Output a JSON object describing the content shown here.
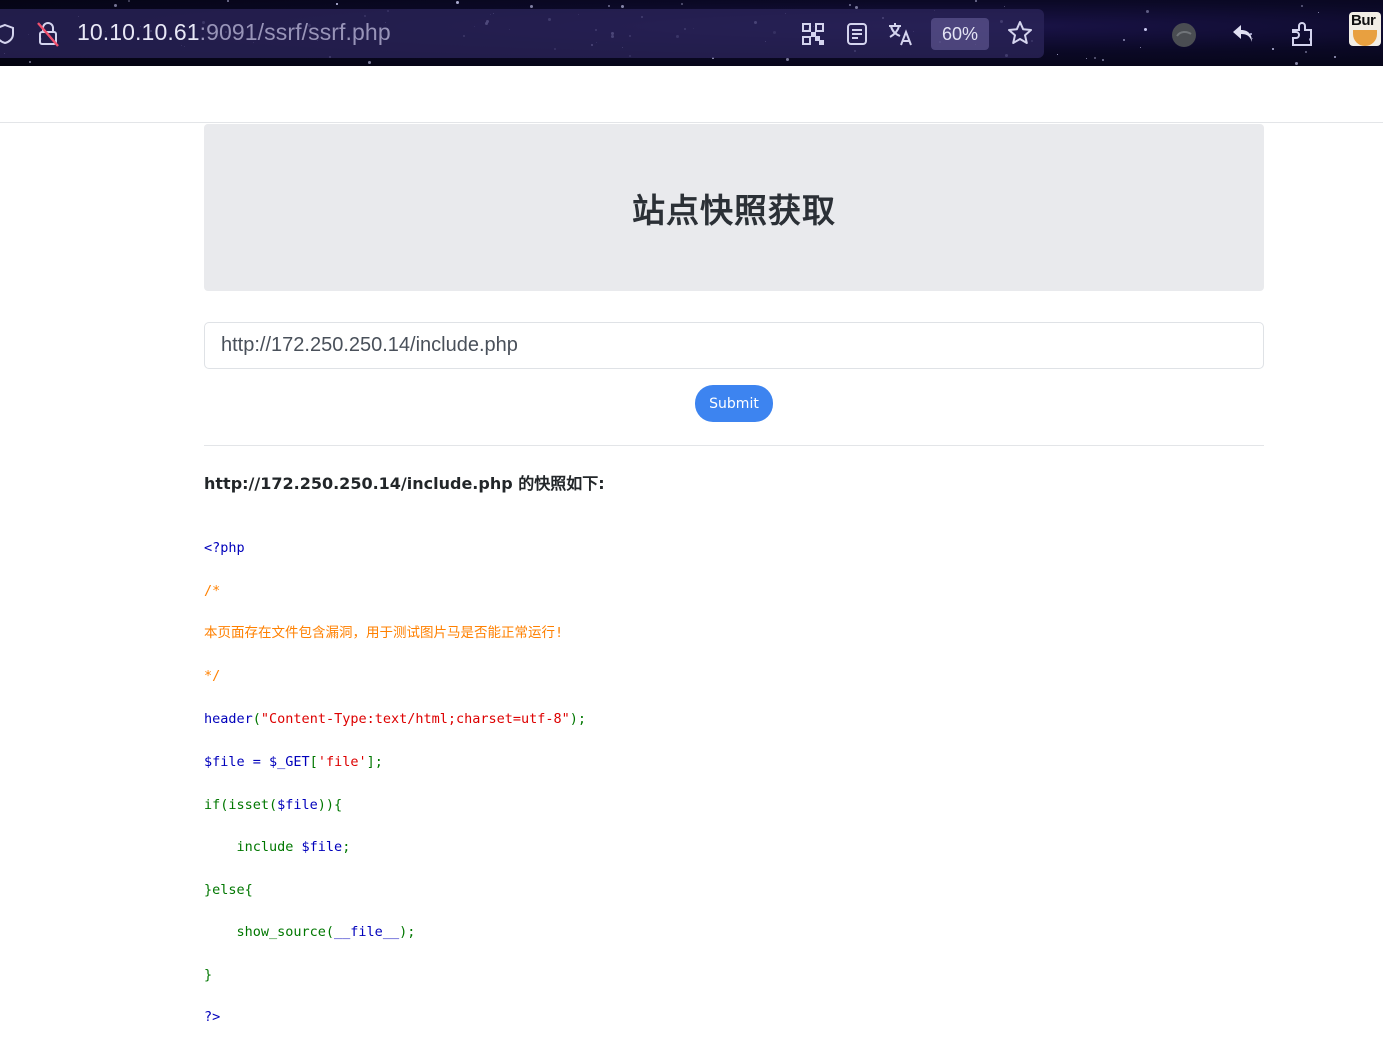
{
  "browser": {
    "url_host": "10.10.10.61",
    "url_path": ":9091/ssrf/ssrf.php",
    "zoom": "60%",
    "burp_label": "Bur",
    "icons": [
      "shield-icon",
      "insecure-lock-icon",
      "qr-code-icon",
      "reader-view-icon",
      "translate-icon",
      "bookmark-star-icon",
      "account-avatar-icon",
      "back-arrow-icon",
      "extensions-icon",
      "burp-extension-icon"
    ]
  },
  "page": {
    "title": "站点快照获取",
    "input_value": "http://172.250.250.14/include.php",
    "submit_label": "Submit",
    "snapshot_heading": "http://172.250.250.14/include.php 的快照如下:"
  },
  "code": {
    "l1": "<?php",
    "l2": "/*",
    "l3": "本页面存在文件包含漏洞，用于测试图片马是否能正常运行!",
    "l4": "*/",
    "l5_fn": "header",
    "l5_open": "(",
    "l5_str": "\"Content-Type:text/html;charset=utf-8\"",
    "l5_close": ");",
    "l6_var": "$file = $_GET",
    "l6_br1": "[",
    "l6_str": "'file'",
    "l6_br2": "];",
    "l7_kw": "if(isset(",
    "l7_var": "$file",
    "l7_kw2": ")){",
    "l8_kw": "    include ",
    "l8_var": "$file",
    "l8_end": ";",
    "l9": "}else{",
    "l10_fn": "    show_source(",
    "l10_var": "__file__",
    "l10_end": ");",
    "l11": "}",
    "l12": "?>"
  },
  "colors": {
    "accent": "#3d84f0",
    "php_tag": "#0000bb",
    "comment": "#ff8000",
    "keyword": "#007700",
    "string": "#dd0000"
  }
}
